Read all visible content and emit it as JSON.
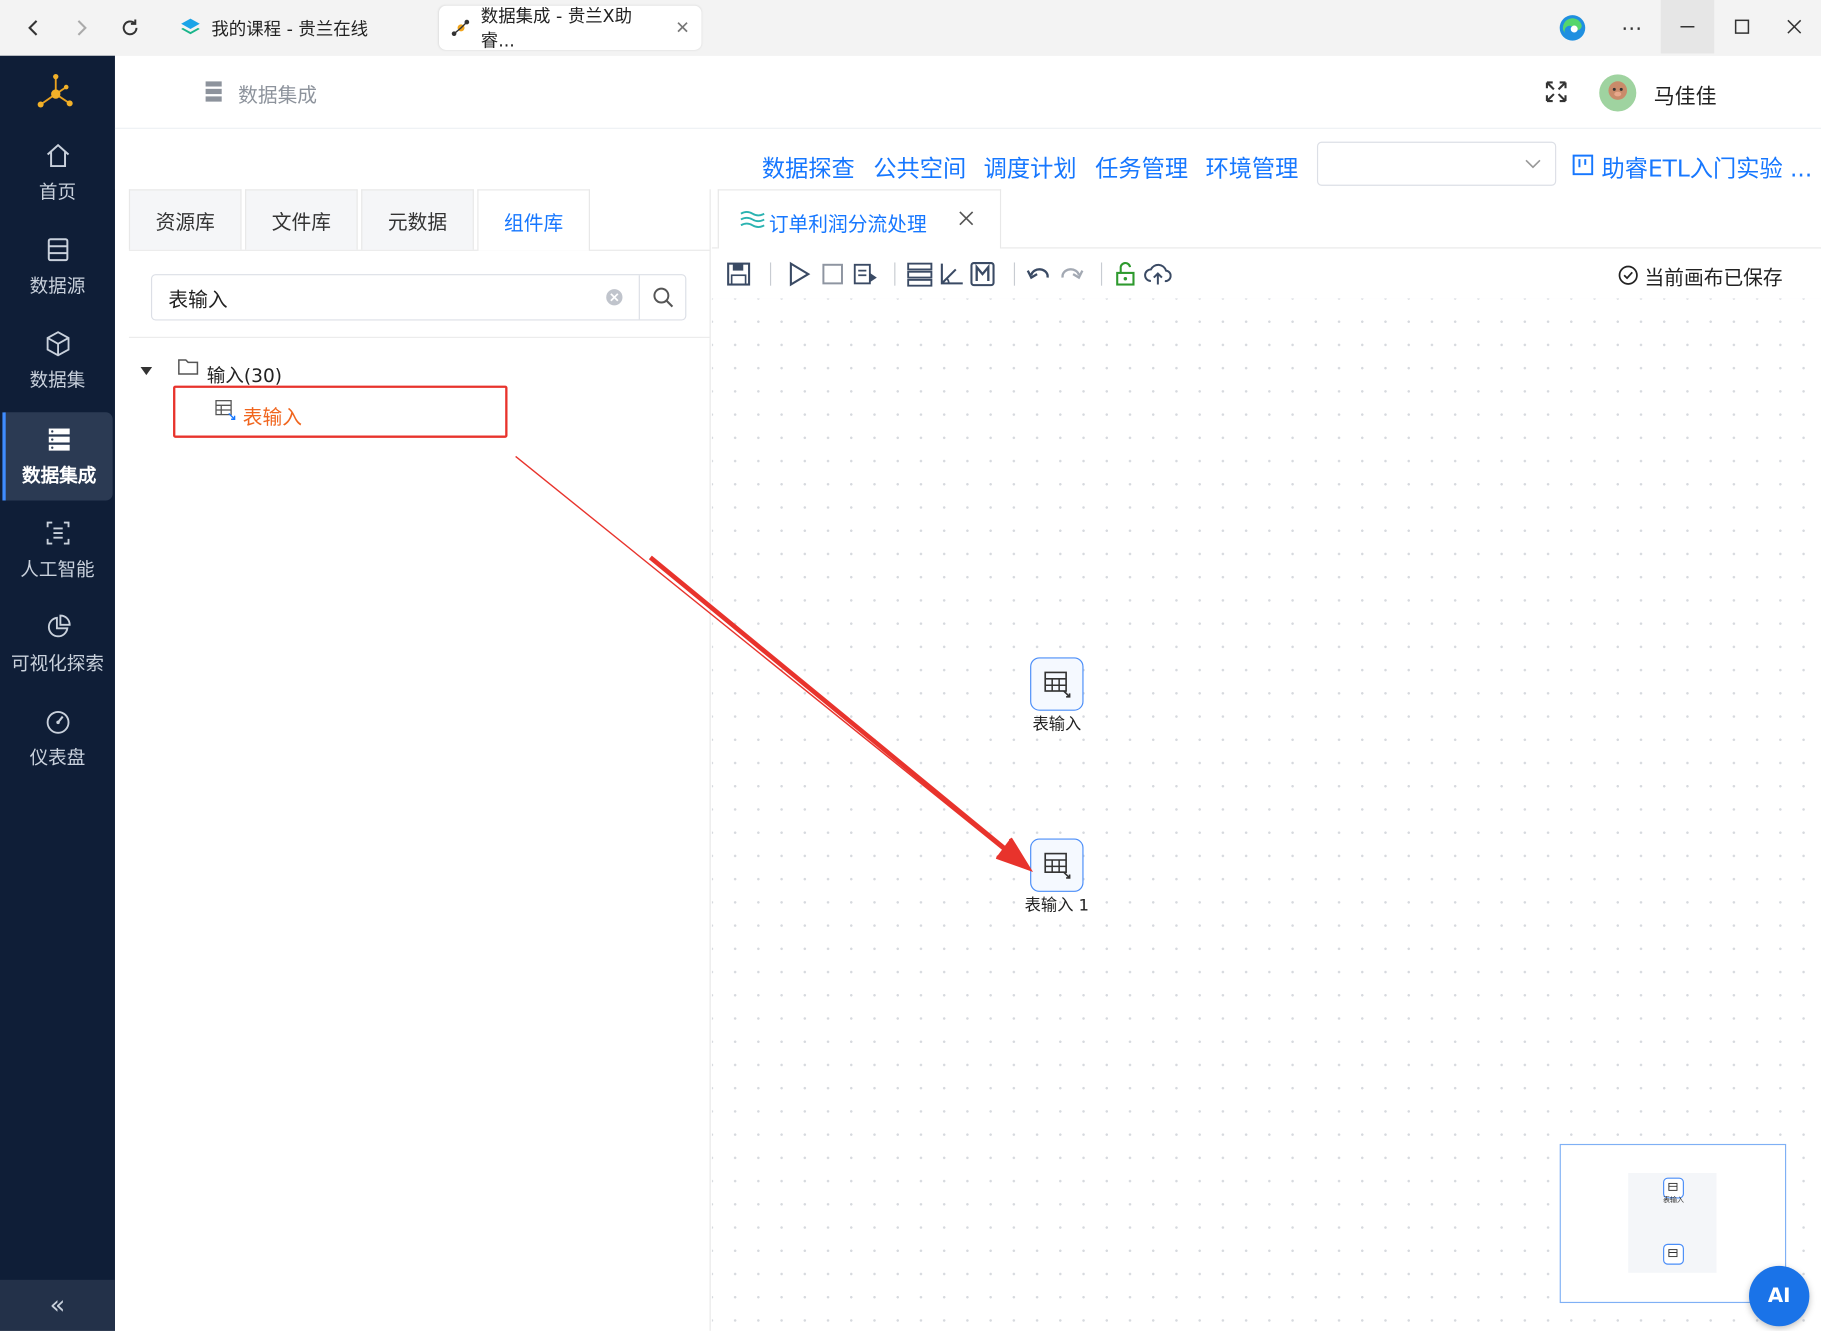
{
  "browser": {
    "tabs": [
      {
        "title": "我的课程 - 贵兰在线"
      },
      {
        "title": "数据集成 - 贵兰X助睿..."
      }
    ]
  },
  "sidebar": {
    "items": [
      {
        "label": "首页",
        "icon": "home-icon"
      },
      {
        "label": "数据源",
        "icon": "database-icon"
      },
      {
        "label": "数据集",
        "icon": "cube-icon"
      },
      {
        "label": "数据集成",
        "icon": "server-icon",
        "active": true
      },
      {
        "label": "人工智能",
        "icon": "ai-icon"
      },
      {
        "label": "可视化探索",
        "icon": "pie-chart-icon"
      },
      {
        "label": "仪表盘",
        "icon": "dashboard-icon"
      }
    ],
    "collapse_symbol": "«"
  },
  "header": {
    "breadcrumb": "数据集成",
    "username": "马佳佳"
  },
  "topnav": {
    "links": [
      "数据探查",
      "公共空间",
      "调度计划",
      "任务管理",
      "环境管理"
    ],
    "select_value": "",
    "project_name": "助睿ETL入门实验 ..."
  },
  "left_panel": {
    "tabs": [
      "资源库",
      "文件库",
      "元数据",
      "组件库"
    ],
    "active_tab": 3,
    "search_value": "表输入",
    "tree": {
      "folder_label": "输入(30)",
      "item_label": "表输入"
    }
  },
  "editor": {
    "tab_title": "订单利润分流处理",
    "save_status": "当前画布已保存"
  },
  "canvas": {
    "nodes": [
      {
        "label": "表输入"
      },
      {
        "label": "表输入 1"
      }
    ],
    "minimap_label": "表输入"
  },
  "ai_button": "AI",
  "colors": {
    "accent": "#1677ff",
    "sidebar_bg": "#0f1e37",
    "highlight": "#e8332c",
    "orange_text": "#f0651e"
  }
}
